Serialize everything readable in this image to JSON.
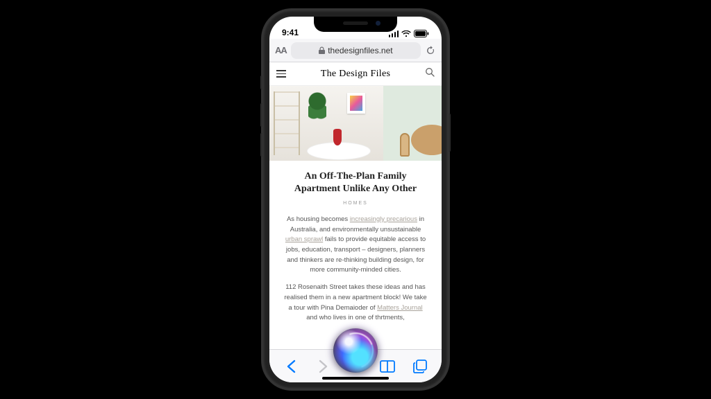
{
  "status": {
    "time": "9:41"
  },
  "safari": {
    "aa_label": "AA",
    "domain": "thedesignfiles.net"
  },
  "site": {
    "title": "The Design Files"
  },
  "article": {
    "headline": "An Off-The-Plan Family Apartment Unlike Any Other",
    "category": "HOMES",
    "p1_a": "As housing becomes ",
    "p1_link1": "increasingly precarious",
    "p1_b": " in Australia, and environmentally unsustainable ",
    "p1_link2": "urban sprawl",
    "p1_c": " fails to provide equitable access to jobs, education, transport – designers, planners and thinkers are re-thinking building design, for more community-minded cities.",
    "p2_a": "112 Rosenaith Street takes these ideas and has realised them in a new apartment block! We take a tour with Pina Demaio",
    "p2_b": "der of ",
    "p2_link1": "Matters Journal",
    "p2_c": " and",
    "p2_d": " who lives in one of th",
    "p2_e": "rtments,"
  }
}
